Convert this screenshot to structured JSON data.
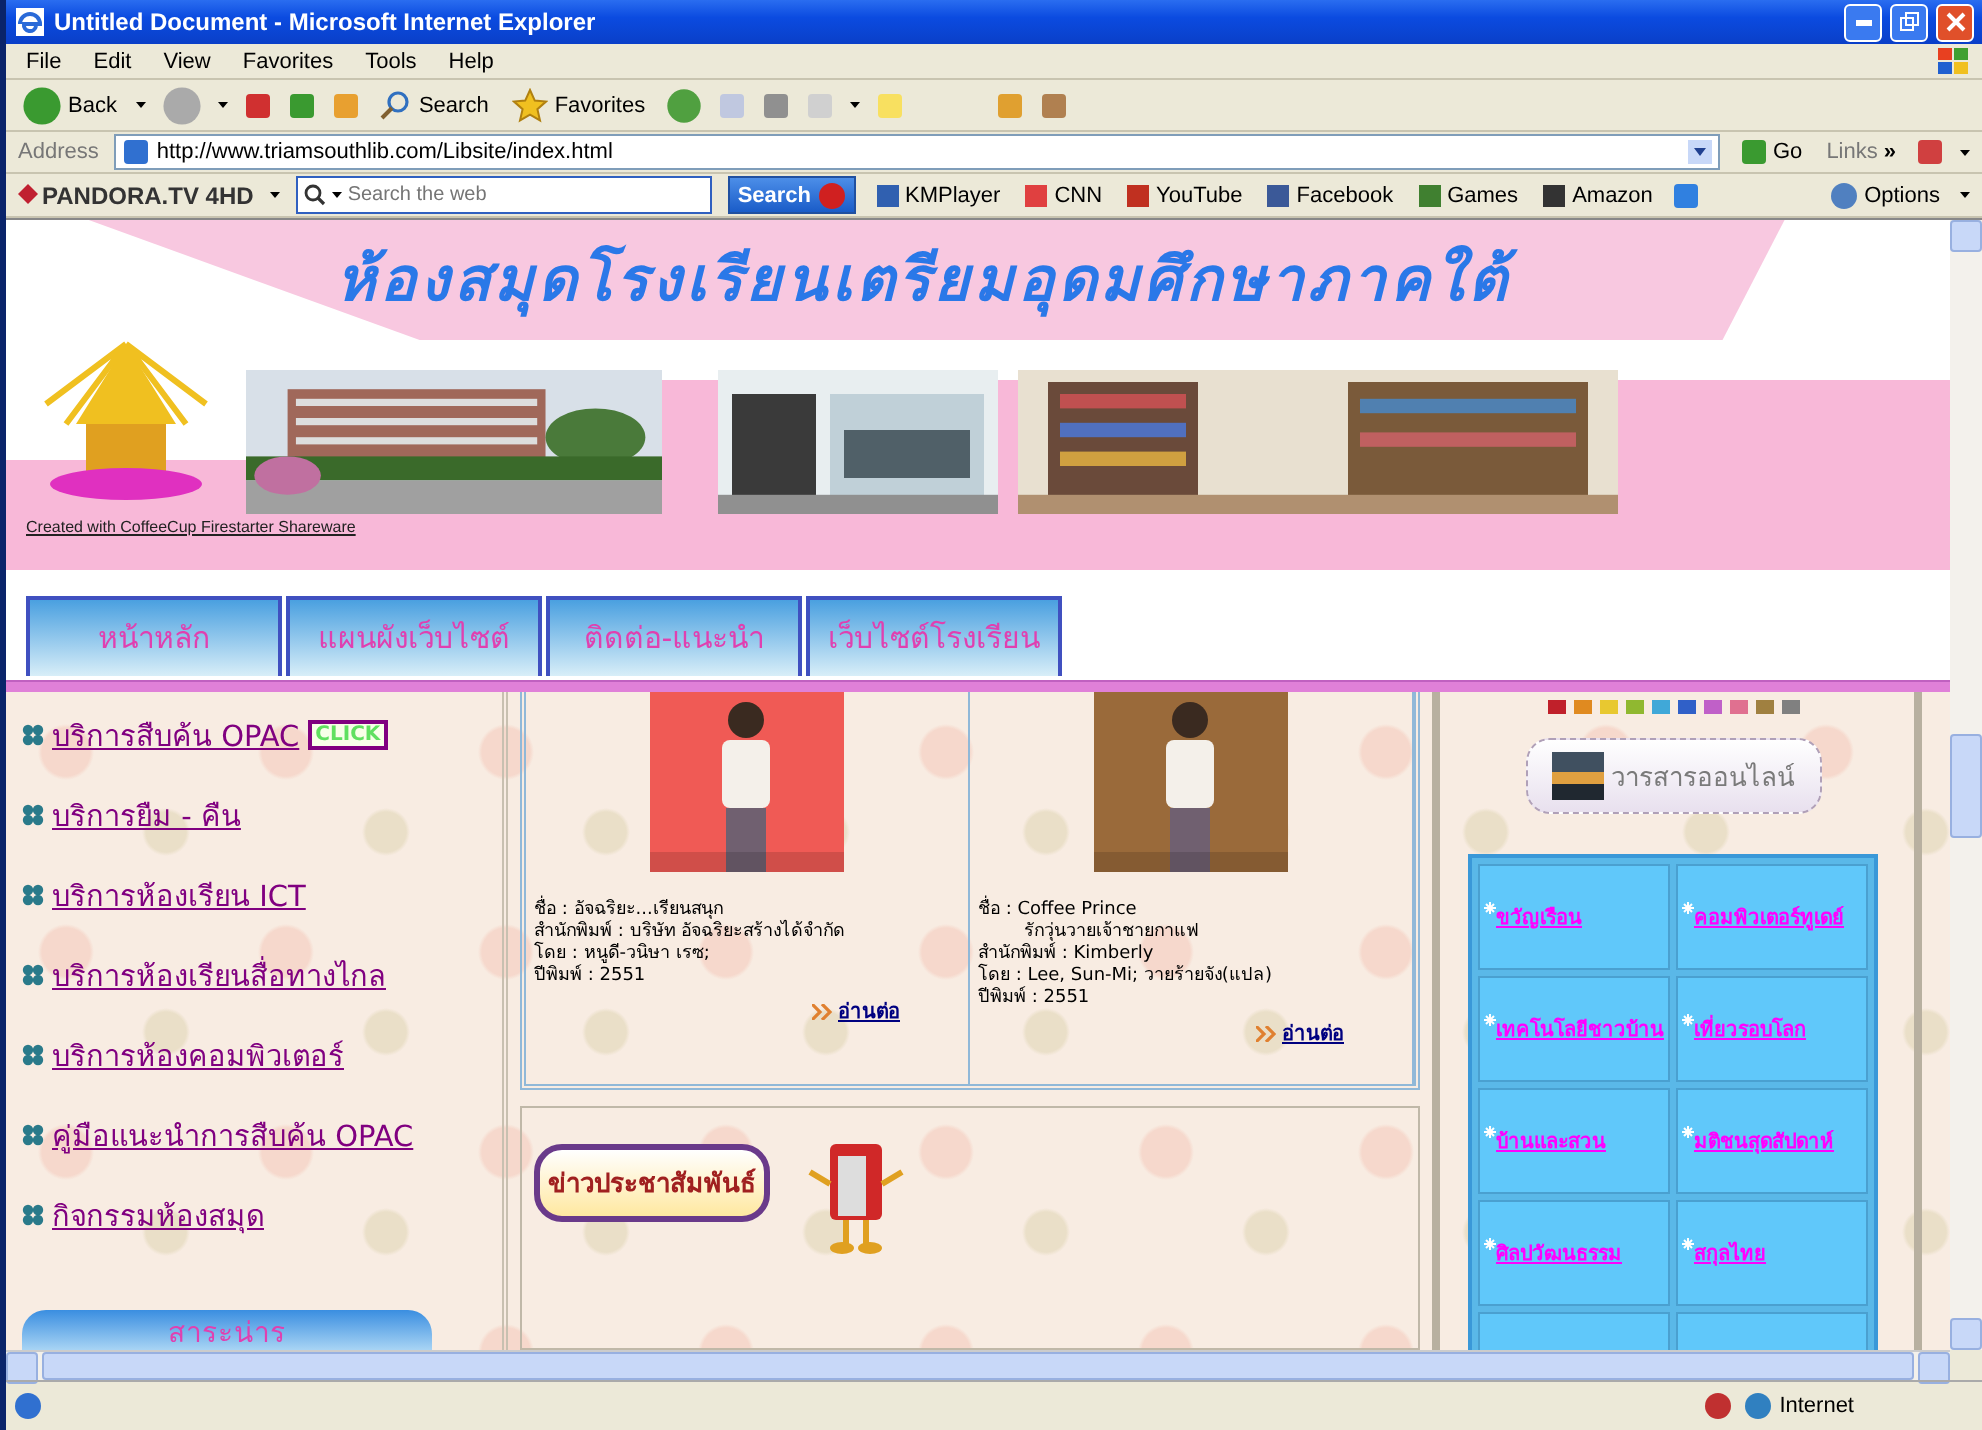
{
  "window": {
    "title": "Untitled Document - Microsoft Internet Explorer"
  },
  "menu": [
    "File",
    "Edit",
    "View",
    "Favorites",
    "Tools",
    "Help"
  ],
  "toolbar": {
    "back": "Back",
    "search": "Search",
    "favorites": "Favorites"
  },
  "address": {
    "label": "Address",
    "url": "http://www.triamsouthlib.com/Libsite/index.html",
    "go": "Go",
    "links": "Links",
    "more": "»"
  },
  "pandora": {
    "brand": "PANDORA.TV",
    "hd": "4HD",
    "placeholder": "Search the web",
    "search": "Search",
    "items": [
      "KMPlayer",
      "CNN",
      "YouTube",
      "Facebook",
      "Games",
      "Amazon"
    ],
    "options": "Options"
  },
  "banner": {
    "title": "ห้องสมุดโรงเรียนเตรียมอุดมศึกษาภาคใต้",
    "credit": "Created with CoffeeCup Firestarter Shareware"
  },
  "nav": [
    "หน้าหลัก",
    "แผนผังเว็บไซต์",
    "ติดต่อ-แนะนำ",
    "เว็บไซต์โรงเรียน"
  ],
  "links": [
    {
      "label": "บริการสืบค้น OPAC",
      "badge": "CLICK"
    },
    {
      "label": "บริการยืม - คืน"
    },
    {
      "label": "บริการห้องเรียน ICT"
    },
    {
      "label": "บริการห้องเรียนสื่อทางไกล"
    },
    {
      "label": "บริการห้องคอมพิวเตอร์"
    },
    {
      "label": "คู่มือแนะนำการสืบค้น OPAC"
    },
    {
      "label": "กิจกรรมห้องสมุด"
    }
  ],
  "side_heading": "สาระน่าร",
  "books": [
    {
      "lines": [
        "ชื่อ : อัจฉริยะ...เรียนสนุก",
        "สำนักพิมพ์ : บริษัท อัจฉริยะสร้างได้จำกัด",
        "โดย : หนูดี-วนิษา เรซ;",
        "ปีพิมพ์ : 2551"
      ],
      "more": "อ่านต่อ"
    },
    {
      "lines": [
        "ชื่อ : Coffee Prince",
        "        รักวุ่นวายเจ้าชายกาแฟ",
        "สำนักพิมพ์ : Kimberly",
        "โดย : Lee, Sun-Mi; วายร้ายจัง(แปล)",
        "ปีพิมพ์ : 2551"
      ],
      "more": "อ่านต่อ"
    }
  ],
  "news": {
    "title": "ข่าวประชาสัมพันธ์"
  },
  "journals": {
    "title": "วารสารออนไลน์",
    "swatches": [
      {
        "color": "#c0202a"
      },
      {
        "color": "#e08a20"
      },
      {
        "color": "#e8c830"
      },
      {
        "color": "#90b830"
      },
      {
        "color": "#40a8d8"
      },
      {
        "color": "#3060c8"
      },
      {
        "color": "#c060c8"
      },
      {
        "color": "#e07090"
      },
      {
        "color": "#a08040"
      },
      {
        "color": "#808080"
      }
    ],
    "items": [
      "ขวัญเรือน",
      "คอมพิวเตอร์ทูเดย์",
      "เทคโนโลยีชาวบ้าน",
      "เที่ยวรอบโลก",
      "บ้านและสวน",
      "มติชนสุดสัปดาห์",
      "ศิลปวัฒนธรรม",
      "สกุลไทย"
    ]
  },
  "status": {
    "zone": "Internet"
  }
}
